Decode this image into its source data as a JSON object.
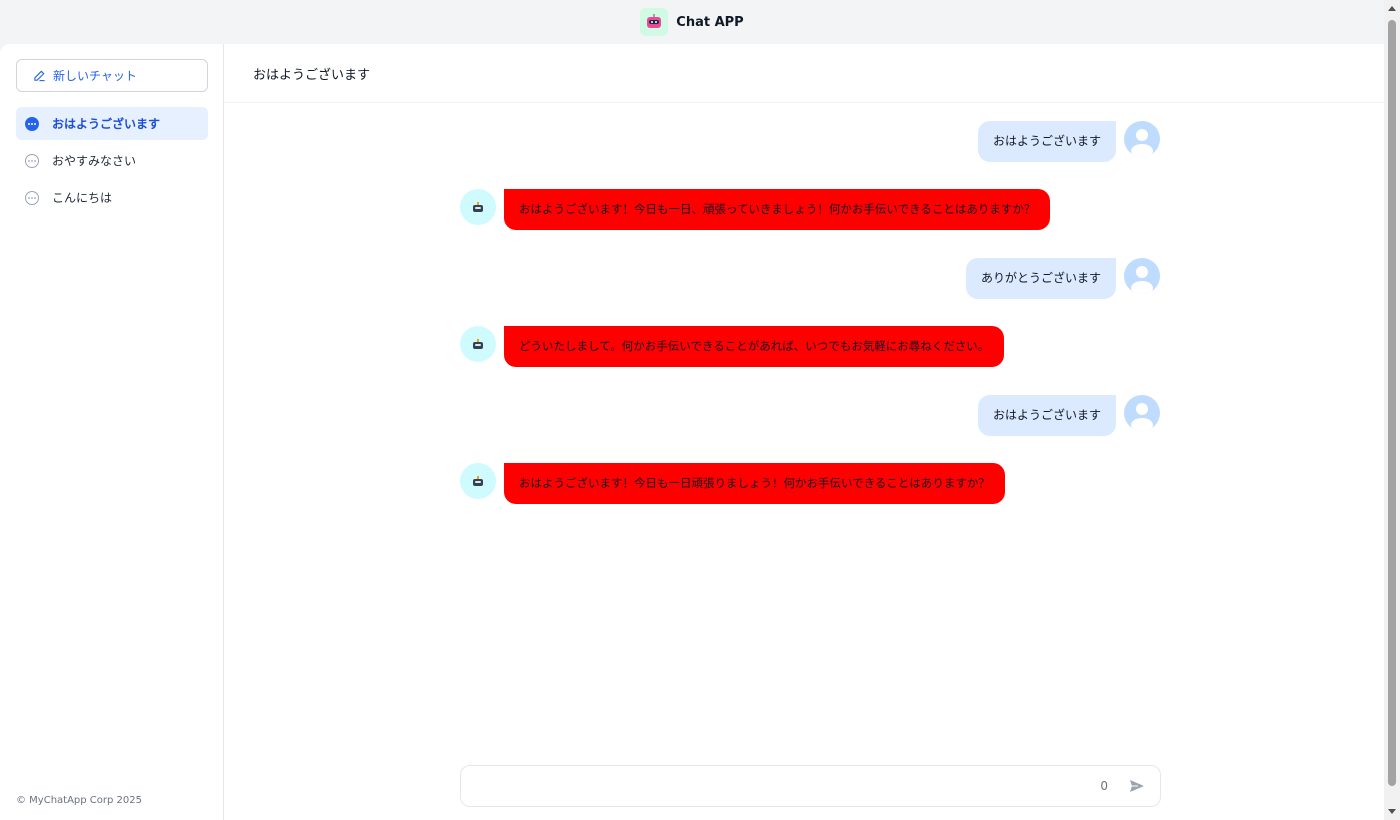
{
  "app": {
    "title": "Chat APP",
    "logo_icon": "robot-icon"
  },
  "sidebar": {
    "new_chat_label": "新しいチャット",
    "conversations": [
      {
        "label": "おはようございます",
        "active": true
      },
      {
        "label": "おやすみなさい",
        "active": false
      },
      {
        "label": "こんにちは",
        "active": false
      }
    ],
    "copyright": "© MyChatApp Corp 2025"
  },
  "main": {
    "header_title": "おはようございます",
    "messages": [
      {
        "role": "user",
        "text": "おはようございます"
      },
      {
        "role": "bot",
        "text": "おはようございます！今日も一日、頑張っていきましょう！何かお手伝いできることはありますか？"
      },
      {
        "role": "user",
        "text": "ありがとうございます"
      },
      {
        "role": "bot",
        "text": "どういたしまして。何かお手伝いできることがあれば、いつでもお気軽にお尋ねください。"
      },
      {
        "role": "user",
        "text": "おはようございます"
      },
      {
        "role": "bot",
        "text": "おはようございます！今日も一日頑張りましょう！何かお手伝いできることはありますか？"
      }
    ],
    "input": {
      "value": "",
      "placeholder": "",
      "char_count": "0"
    }
  },
  "colors": {
    "accent": "#2563eb",
    "user_bubble": "#dbeafe",
    "bot_bubble": "#ff0000",
    "active_item_bg": "#e6f0ff"
  }
}
